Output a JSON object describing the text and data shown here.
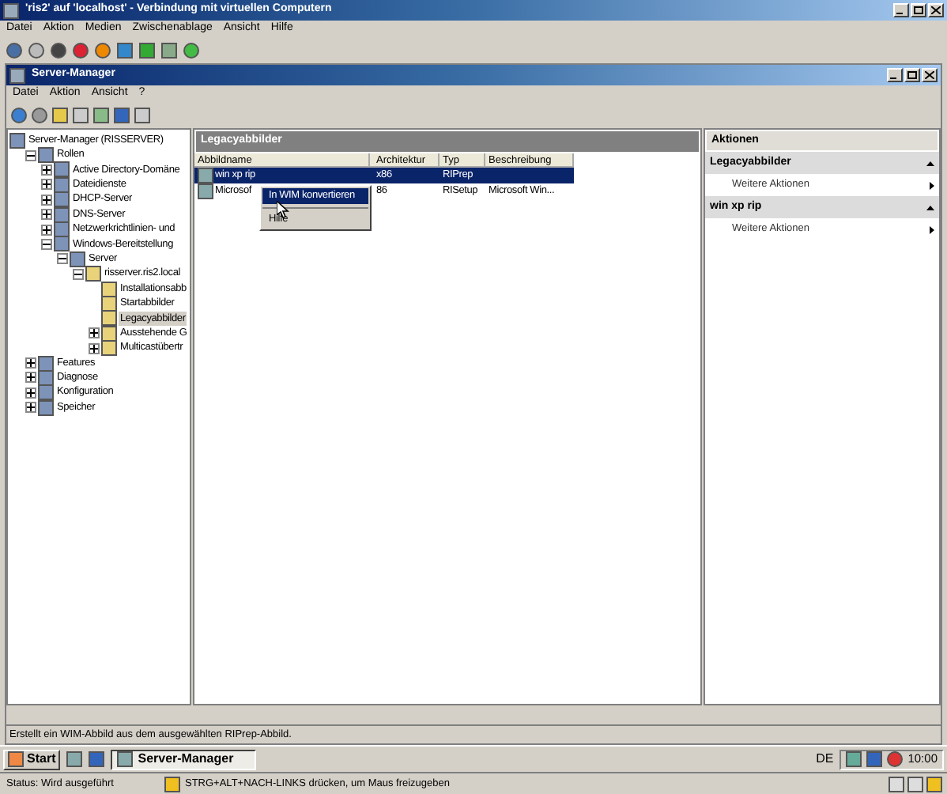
{
  "vm_window": {
    "title": "'ris2' auf 'localhost' - Verbindung mit virtuellen Computern",
    "menu": [
      "Datei",
      "Aktion",
      "Medien",
      "Zwischenablage",
      "Ansicht",
      "Hilfe"
    ]
  },
  "app_window": {
    "title": "Server-Manager",
    "menu": [
      "Datei",
      "Aktion",
      "Ansicht",
      "?"
    ]
  },
  "tree": [
    {
      "label": "Server-Manager (RISSERVER)",
      "selected": false,
      "children": [
        {
          "label": "Rollen",
          "expanded": true,
          "selected": false,
          "children": [
            {
              "label": "Active Directory-Domäne",
              "expanded": false,
              "selected": false
            },
            {
              "label": "Dateidienste",
              "expanded": false,
              "selected": false
            },
            {
              "label": "DHCP-Server",
              "expanded": false,
              "selected": false
            },
            {
              "label": "DNS-Server",
              "expanded": false,
              "selected": false
            },
            {
              "label": "Netzwerkrichtlinien- und",
              "expanded": false,
              "selected": false
            },
            {
              "label": "Windows-Bereitstellung",
              "expanded": true,
              "selected": false,
              "children": [
                {
                  "label": "Server",
                  "expanded": true,
                  "selected": false,
                  "children": [
                    {
                      "label": "risserver.ris2.local",
                      "expanded": true,
                      "selected": false,
                      "children": [
                        {
                          "label": "Installationsabb",
                          "selected": false
                        },
                        {
                          "label": "Startabbilder",
                          "selected": false
                        },
                        {
                          "label": "Legacyabbilder",
                          "selected": true
                        },
                        {
                          "label": "Ausstehende G",
                          "expanded": false,
                          "selected": false
                        },
                        {
                          "label": "Multicastübertr",
                          "expanded": false,
                          "selected": false
                        }
                      ]
                    }
                  ]
                }
              ]
            }
          ]
        },
        {
          "label": "Features",
          "expanded": false,
          "selected": false
        },
        {
          "label": "Diagnose",
          "expanded": false,
          "selected": false
        },
        {
          "label": "Konfiguration",
          "expanded": false,
          "selected": false
        },
        {
          "label": "Speicher",
          "expanded": false,
          "selected": false
        }
      ]
    }
  ],
  "center": {
    "title": "Legacyabbilder",
    "columns": [
      "Abbildname",
      "Architektur",
      "Typ",
      "Beschreibung"
    ],
    "rows": [
      {
        "cells": [
          "win xp rip",
          "x86",
          "RIPrep",
          ""
        ],
        "selected": true
      },
      {
        "cells": [
          "Microsof",
          "86",
          "RISetup",
          "Microsoft Win..."
        ],
        "selected": false
      }
    ],
    "context_menu": [
      {
        "label": "In WIM konvertieren",
        "selected": true
      },
      {
        "label": "Hilfe",
        "selected": false
      }
    ]
  },
  "actions": {
    "title": "Aktionen",
    "sections": [
      {
        "title": "Legacyabbilder",
        "items": [
          "Weitere Aktionen"
        ]
      },
      {
        "title": "win xp rip",
        "items": [
          "Weitere Aktionen"
        ]
      }
    ]
  },
  "status_bar": "Erstellt ein WIM-Abbild aus dem ausgewählten RIPrep-Abbild.",
  "taskbar": {
    "start": "Start",
    "tasks": [
      {
        "label": "Server-Manager",
        "selected": true
      }
    ],
    "language": "DE",
    "clock": "10:00"
  },
  "vm_status": {
    "status": "Status: Wird ausgeführt",
    "hint": "STRG+ALT+NACH-LINKS drücken, um Maus freizugeben"
  }
}
